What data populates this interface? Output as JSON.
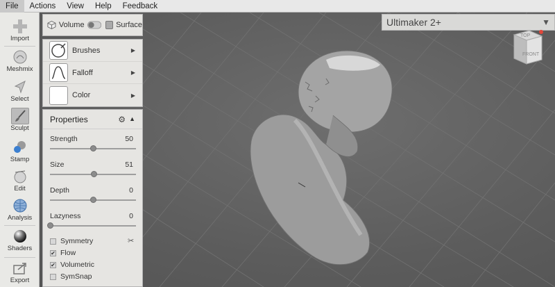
{
  "menu": [
    "File",
    "Actions",
    "View",
    "Help",
    "Feedback"
  ],
  "tools": [
    {
      "label": "Import",
      "icon": "plus-icon"
    },
    {
      "label": "Meshmix",
      "icon": "meshmix-icon"
    },
    {
      "label": "Select",
      "icon": "select-arrow-icon"
    },
    {
      "label": "Sculpt",
      "icon": "brush-icon"
    },
    {
      "label": "Stamp",
      "icon": "stamp-icon"
    },
    {
      "label": "Edit",
      "icon": "edit-icon"
    },
    {
      "label": "Analysis",
      "icon": "analysis-globe-icon"
    },
    {
      "label": "Shaders",
      "icon": "shader-sphere-icon"
    },
    {
      "label": "Export",
      "icon": "export-icon"
    }
  ],
  "mode": {
    "volume": "Volume",
    "surface": "Surface"
  },
  "brush_panel": {
    "brushes": "Brushes",
    "falloff": "Falloff",
    "color": "Color"
  },
  "properties": {
    "title": "Properties",
    "sliders": [
      {
        "label": "Strength",
        "value": "50",
        "fraction": 0.5
      },
      {
        "label": "Size",
        "value": "51",
        "fraction": 0.51
      },
      {
        "label": "Depth",
        "value": "0",
        "fraction": 0.5
      },
      {
        "label": "Lazyness",
        "value": "0",
        "fraction": 0.0
      }
    ],
    "checks": [
      {
        "label": "Symmetry",
        "checked": false
      },
      {
        "label": "Flow",
        "checked": true
      },
      {
        "label": "Volumetric",
        "checked": true
      },
      {
        "label": "SymSnap",
        "checked": false
      }
    ]
  },
  "printer": "Ultimaker 2+",
  "view_cube": {
    "top": "TOP",
    "front": "FRONT"
  },
  "colors": {
    "accent_red": "#e0463a",
    "panel": "#e6e5e2",
    "viewport": "#5c5c5c"
  }
}
